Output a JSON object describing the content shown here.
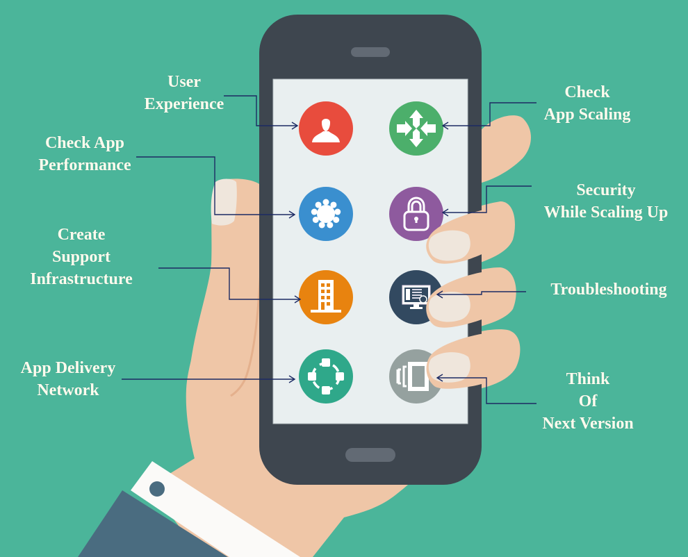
{
  "colors": {
    "background": "#4bb59a",
    "phone_body": "#3e464f",
    "phone_screen": "#e9eff0",
    "phone_speaker": "#626a74",
    "skin": "#efc6a7",
    "skin_shadow": "#e4b08d",
    "nail": "#efe6dc",
    "cuff": "#fbfaf8",
    "sleeve": "#4a6c80",
    "connector": "#1c2a63",
    "label_text": "#fffbee"
  },
  "features": [
    {
      "id": "user-experience",
      "lines": [
        "User",
        "Experience"
      ],
      "icon": "user-icon",
      "color": "#e84c3d",
      "side": "left"
    },
    {
      "id": "check-app-scaling",
      "lines": [
        "Check",
        "App Scaling"
      ],
      "icon": "arrows-converge-icon",
      "color": "#4caf6b",
      "side": "right"
    },
    {
      "id": "check-app-performance",
      "lines": [
        "Check App",
        "Performance"
      ],
      "icon": "gear-icon",
      "color": "#3a8fcf",
      "side": "left"
    },
    {
      "id": "security-while-scaling-up",
      "lines": [
        "Security",
        "While Scaling Up"
      ],
      "icon": "lock-icon",
      "color": "#8e5a9e",
      "side": "right"
    },
    {
      "id": "create-support-infrastructure",
      "lines": [
        "Create",
        "Support",
        "Infrastructure"
      ],
      "icon": "building-icon",
      "color": "#e8830f",
      "side": "left"
    },
    {
      "id": "troubleshooting",
      "lines": [
        "Troubleshooting"
      ],
      "icon": "monitor-help-icon",
      "color": "#324960",
      "side": "right"
    },
    {
      "id": "app-delivery-network",
      "lines": [
        "App Delivery",
        "Network"
      ],
      "icon": "network-nodes-icon",
      "color": "#2fa88a",
      "side": "left"
    },
    {
      "id": "think-of-next-version",
      "lines": [
        "Think",
        "Of",
        "Next Version"
      ],
      "icon": "next-version-icon",
      "color": "#95a19f",
      "side": "right"
    }
  ]
}
